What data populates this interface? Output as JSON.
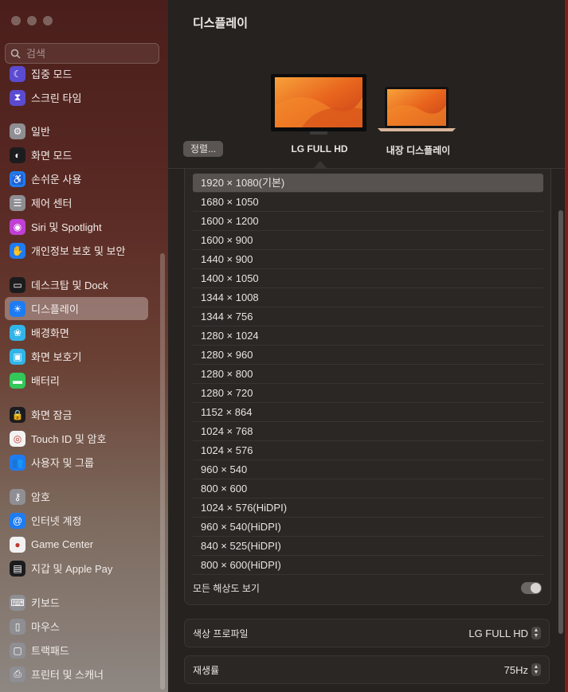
{
  "sidebar": {
    "search_placeholder": "검색",
    "items": [
      {
        "label": "집중 모드",
        "icon": "moon-icon",
        "color": "#5b4bd1"
      },
      {
        "label": "스크린 타임",
        "icon": "hourglass-icon",
        "color": "#5b4bd1"
      },
      {
        "label": "일반",
        "icon": "gear-icon",
        "color": "#8e8e93"
      },
      {
        "label": "화면 모드",
        "icon": "appearance-icon",
        "color": "#1c1c1e"
      },
      {
        "label": "손쉬운 사용",
        "icon": "accessibility-icon",
        "color": "#1e7cf2"
      },
      {
        "label": "제어 센터",
        "icon": "control-center-icon",
        "color": "#8e8e93"
      },
      {
        "label": "Siri 및 Spotlight",
        "icon": "siri-icon",
        "color": "#c03fd4"
      },
      {
        "label": "개인정보 보호 및 보안",
        "icon": "hand-icon",
        "color": "#1e7cf2"
      },
      {
        "label": "데스크탑 및 Dock",
        "icon": "dock-icon",
        "color": "#1c1c1e"
      },
      {
        "label": "디스플레이",
        "icon": "sun-icon",
        "color": "#1e7cf2"
      },
      {
        "label": "배경화면",
        "icon": "flower-icon",
        "color": "#31b5e8"
      },
      {
        "label": "화면 보호기",
        "icon": "screensaver-icon",
        "color": "#31b5e8"
      },
      {
        "label": "배터리",
        "icon": "battery-icon",
        "color": "#34c759"
      },
      {
        "label": "화면 잠금",
        "icon": "lock-icon",
        "color": "#1c1c1e"
      },
      {
        "label": "Touch ID 및 암호",
        "icon": "fingerprint-icon",
        "color": "#f2f2f2"
      },
      {
        "label": "사용자 및 그룹",
        "icon": "users-icon",
        "color": "#1e7cf2"
      },
      {
        "label": "암호",
        "icon": "key-icon",
        "color": "#8e8e93"
      },
      {
        "label": "인터넷 계정",
        "icon": "at-icon",
        "color": "#1e7cf2"
      },
      {
        "label": "Game Center",
        "icon": "game-center-icon",
        "color": "#f2f2f2"
      },
      {
        "label": "지갑 및 Apple Pay",
        "icon": "wallet-icon",
        "color": "#1c1c1e"
      },
      {
        "label": "키보드",
        "icon": "keyboard-icon",
        "color": "#8e8e93"
      },
      {
        "label": "마우스",
        "icon": "mouse-icon",
        "color": "#8e8e93"
      },
      {
        "label": "트랙패드",
        "icon": "trackpad-icon",
        "color": "#8e8e93"
      },
      {
        "label": "프린터 및 스캐너",
        "icon": "printer-icon",
        "color": "#8e8e93"
      }
    ],
    "active": "디스플레이"
  },
  "main": {
    "title": "디스플레이",
    "sort_button": "정렬...",
    "monitors": [
      {
        "label": "LG FULL HD",
        "selected": true
      },
      {
        "label": "내장 디스플레이",
        "selected": false
      }
    ],
    "resolutions": [
      "1920 × 1080(기본)",
      "1680 × 1050",
      "1600 × 1200",
      "1600 × 900",
      "1440 × 900",
      "1400 × 1050",
      "1344 × 1008",
      "1344 × 756",
      "1280 × 1024",
      "1280 × 960",
      "1280 × 800",
      "1280 × 720",
      "1152 × 864",
      "1024 × 768",
      "1024 × 576",
      "960 × 540",
      "800 × 600",
      "1024 × 576(HiDPI)",
      "960 × 540(HiDPI)",
      "840 × 525(HiDPI)",
      "800 × 600(HiDPI)"
    ],
    "selected_resolution": "1920 × 1080(기본)",
    "show_all_label": "모든 해상도 보기",
    "show_all_on": true,
    "color_profile": {
      "label": "색상 프로파일",
      "value": "LG FULL HD"
    },
    "refresh_rate": {
      "label": "재생률",
      "value": "75Hz"
    }
  }
}
